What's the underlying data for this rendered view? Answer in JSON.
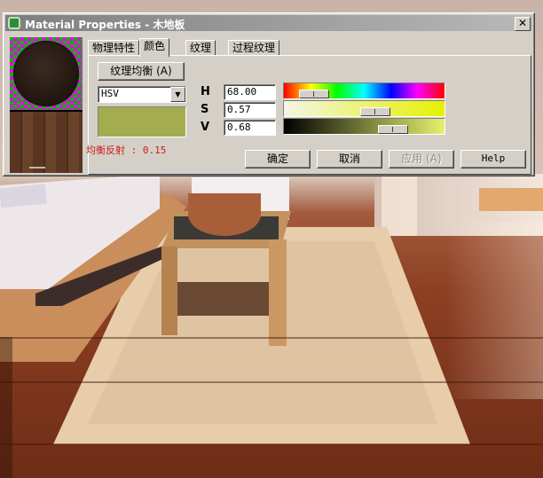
{
  "window": {
    "title": "Material Properties - 木地板",
    "close_label": "✕",
    "app_icon": "material-app-icon"
  },
  "tabs": [
    {
      "label": "物理特性"
    },
    {
      "label": "颜色",
      "active": true
    },
    {
      "label": "纹理"
    },
    {
      "label": "过程纹理"
    }
  ],
  "color_panel": {
    "texture_balance_button": "纹理均衡 (A)",
    "color_model": "HSV",
    "swatch_color": "#a3ad4f",
    "reflect_balance": "均衡反射 : 0.15",
    "channels": [
      {
        "name": "H",
        "value": "68.00",
        "level": 0.19
      },
      {
        "name": "S",
        "value": "0.57",
        "level": 0.57
      },
      {
        "name": "V",
        "value": "0.68",
        "level": 0.68
      }
    ]
  },
  "buttons": {
    "ok": "确定",
    "cancel": "取消",
    "apply": "应用 (A)",
    "help": "Help"
  }
}
